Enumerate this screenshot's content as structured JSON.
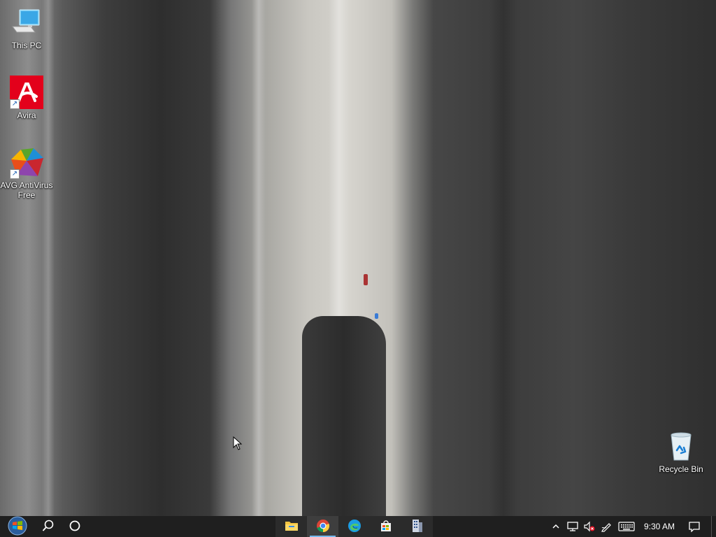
{
  "desktop": {
    "icons": [
      {
        "label": "This PC"
      },
      {
        "label": "Avira"
      },
      {
        "label": "AVG AntiVirus Free"
      },
      {
        "label": "Recycle Bin"
      }
    ]
  },
  "taskbar": {
    "start_icon": "windows-start-icon",
    "search_icon": "search-icon",
    "cortana_icon": "cortana-circle-icon",
    "pinned": [
      {
        "name": "File Explorer",
        "icon": "folder-icon"
      },
      {
        "name": "Google Chrome",
        "icon": "chrome-icon",
        "active": true
      },
      {
        "name": "Microsoft Edge",
        "icon": "edge-icon"
      },
      {
        "name": "Microsoft Store",
        "icon": "store-icon"
      },
      {
        "name": "App",
        "icon": "building-icon"
      }
    ],
    "tray": {
      "clock": "9:30 AM",
      "icons": [
        "chevron-up-icon",
        "network-icon",
        "volume-muted-icon",
        "pen-icon",
        "keyboard-icon",
        "notification-icon"
      ]
    }
  },
  "colors": {
    "taskbar_bg": "#1f1f1f",
    "active_indicator": "#76b9ed",
    "avira_red": "#e3001b"
  }
}
